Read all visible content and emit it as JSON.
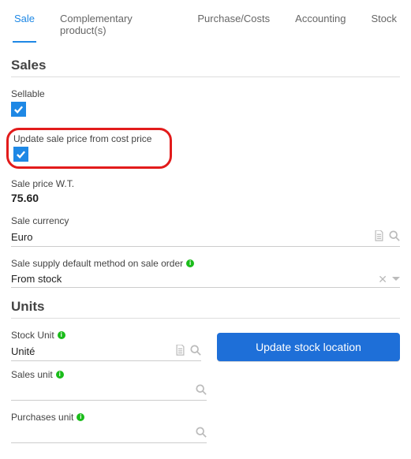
{
  "tabs": {
    "sale": "Sale",
    "complementary": "Complementary product(s)",
    "purchase": "Purchase/Costs",
    "accounting": "Accounting",
    "stock": "Stock"
  },
  "sections": {
    "sales": "Sales",
    "units": "Units"
  },
  "fields": {
    "sellable": {
      "label": "Sellable",
      "checked": true
    },
    "update_from_cost": {
      "label": "Update sale price from cost price",
      "checked": true
    },
    "sale_price_wt": {
      "label": "Sale price W.T.",
      "value": "75.60"
    },
    "sale_currency": {
      "label": "Sale currency",
      "value": "Euro"
    },
    "supply_method": {
      "label": "Sale supply default method on sale order",
      "value": "From stock"
    },
    "stock_unit": {
      "label": "Stock Unit",
      "value": "Unité"
    },
    "sales_unit": {
      "label": "Sales unit",
      "value": ""
    },
    "purchases_unit": {
      "label": "Purchases unit",
      "value": ""
    }
  },
  "buttons": {
    "update_stock_location": "Update stock location"
  }
}
